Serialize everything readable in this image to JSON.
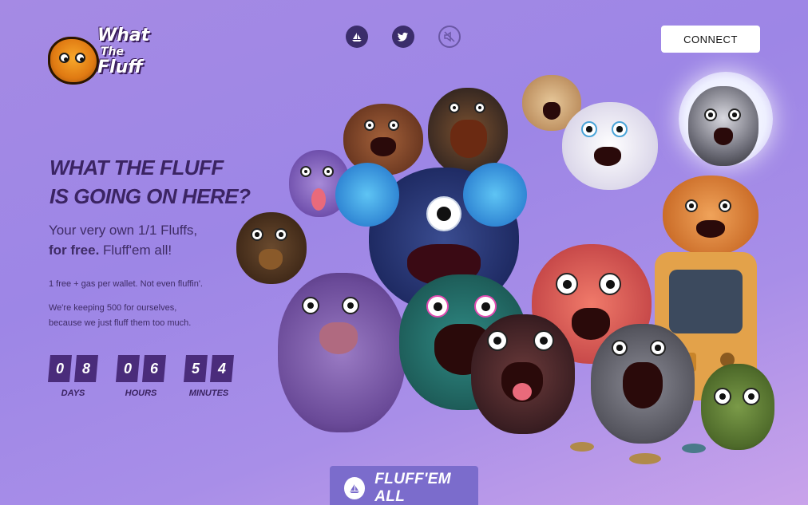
{
  "logo": {
    "line1": "What",
    "line2": "The",
    "line3": "Fluff"
  },
  "top_icons": [
    "opensea-icon",
    "twitter-icon",
    "sound-muted-icon"
  ],
  "connect": {
    "label": "CONNECT"
  },
  "hero": {
    "title_line1": "WHAT THE FLUFF",
    "title_line2": "IS GOING ON HERE?",
    "sub_line1": "Your very own 1/1 Fluffs,",
    "sub_bold": "for free.",
    "sub_rest": " Fluff'em all!",
    "note1": "1 free + gas per wallet. Not even fluffin'.",
    "note2_line1": "We're keeping 500 for ourselves,",
    "note2_line2": "because we just fluff them too much."
  },
  "countdown": [
    {
      "digits": [
        "0",
        "8"
      ],
      "label": "DAYS"
    },
    {
      "digits": [
        "0",
        "6"
      ],
      "label": "HOURS"
    },
    {
      "digits": [
        "5",
        "4"
      ],
      "label": "MINUTES"
    }
  ],
  "cta": {
    "label": "FLUFF'EM ALL",
    "icon": "opensea-icon"
  },
  "colors": {
    "accent_dark": "#3b2463",
    "digit_bg": "#4a2c7b",
    "cta_bg": "#7b6ccc"
  }
}
